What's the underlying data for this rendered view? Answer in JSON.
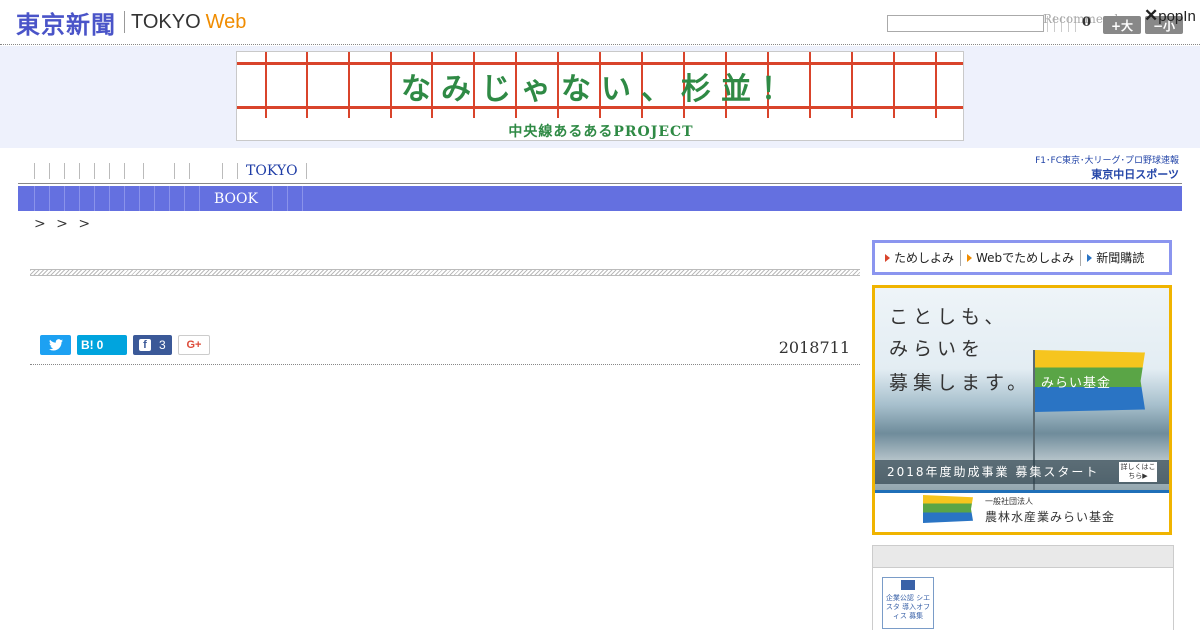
{
  "header": {
    "logo_jp": "東京新聞",
    "logo_tokyo": "TOKYO",
    "logo_web": "Web",
    "search_placeholder": "",
    "recommend_label": "Recommend",
    "count": "0",
    "font_big_label": "+大",
    "font_small_label": "−小",
    "popin_label": "popIn",
    "popin_close": "✕"
  },
  "ad_banner": {
    "title": "なみじゃない、杉並！",
    "subtitle": "中央線あるあるPROJECT",
    "colors": {
      "rail": "#d9442b",
      "text": "#2f8a45"
    }
  },
  "nav": {
    "primary_active": "TOKYO",
    "secondary_active": "BOOK",
    "chunichi_line1": "F1･FC東京･大リーグ･プロ野球速報",
    "chunichi_line2": "東京中日スポーツ",
    "accent_color": "#6470e0"
  },
  "breadcrumb": ">   > >",
  "article": {
    "date": "2018711",
    "share": {
      "twitter_icon": "twitter-bird-icon",
      "hatena_label": "B!",
      "hatena_count": "0",
      "facebook_label": "f",
      "facebook_count": "3",
      "gplus_label": "G+"
    }
  },
  "sidebar": {
    "trial_links": [
      "ためしよみ",
      "Webでためしよみ",
      "新聞購読"
    ],
    "mirai_ad": {
      "copy": [
        "ことしも、",
        "みらいを",
        "募集します。"
      ],
      "flag_text": "みらい基金",
      "strip_text": "2018年度助成事業 募集スタート",
      "more_label": "詳しくはこちら▶",
      "org_line1": "一般社団法人",
      "org_line2": "農林水産業みらい基金"
    },
    "badge_text": "企業公認 シエスタ 導入オフィス 募集"
  }
}
